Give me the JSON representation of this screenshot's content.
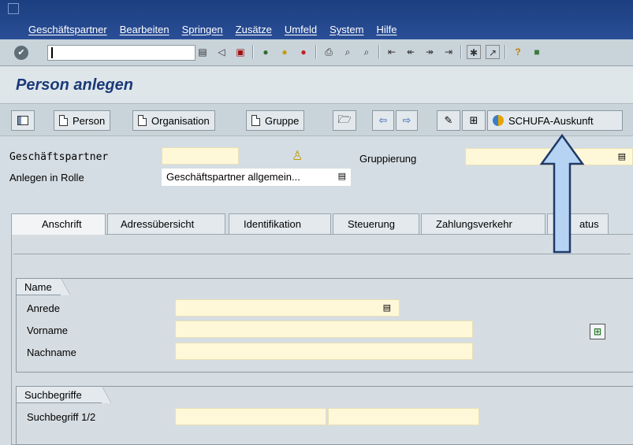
{
  "menubar": {
    "items": [
      "Geschäftspartner",
      "Bearbeiten",
      "Springen",
      "Zusätze",
      "Umfeld",
      "System",
      "Hilfe"
    ]
  },
  "std_toolbar": {
    "command_value": "",
    "icons": [
      "enter-icon",
      "save-icon",
      "back-icon",
      "exit-icon",
      "cancel-icon",
      "print-icon",
      "find-icon",
      "find-next-icon",
      "first-page-icon",
      "prev-page-icon",
      "next-page-icon",
      "last-page-icon",
      "new-session-icon",
      "shortcut-icon",
      "help-icon",
      "layout-icon"
    ]
  },
  "title": "Person anlegen",
  "app_toolbar": {
    "person": "Person",
    "organisation": "Organisation",
    "gruppe": "Gruppe",
    "schufa": "SCHUFA-Auskunft"
  },
  "header": {
    "gp_label": "Geschäftspartner",
    "gp_value": "",
    "rolle_label": "Anlegen in Rolle",
    "rolle_value": "Geschäftspartner allgemein...",
    "gruppierung_label": "Gruppierung",
    "gruppierung_value": ""
  },
  "tabs": [
    "Anschrift",
    "Adressübersicht",
    "Identifikation",
    "Steuerung",
    "Zahlungsverkehr",
    "atus"
  ],
  "name_group": {
    "title": "Name",
    "anrede": "Anrede",
    "vorname": "Vorname",
    "nachname": "Nachname"
  },
  "suchbegriffe_group": {
    "title": "Suchbegriffe",
    "suchbegriff": "Suchbegriff 1/2"
  },
  "colors": {
    "menubar": "#1c3f80",
    "title_text": "#1a3a78",
    "required_field": "#fff8d8",
    "arrow_fill": "#b6d3f3",
    "arrow_stroke": "#1f3a6a"
  }
}
